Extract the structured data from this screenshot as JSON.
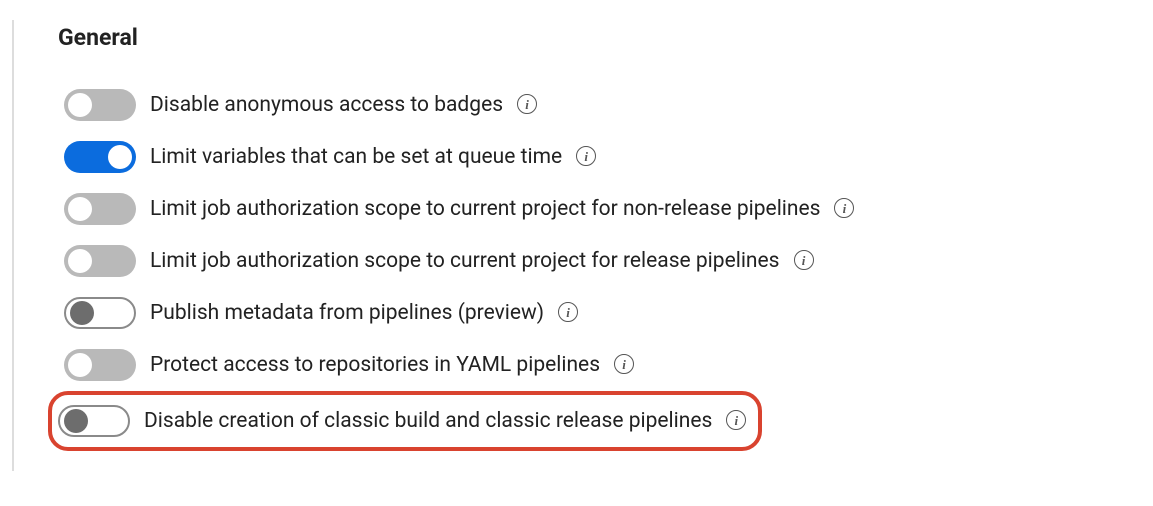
{
  "section": {
    "title": "General"
  },
  "settings": [
    {
      "label": "Disable anonymous access to badges",
      "state": "off-filled"
    },
    {
      "label": "Limit variables that can be set at queue time",
      "state": "on"
    },
    {
      "label": "Limit job authorization scope to current project for non-release pipelines",
      "state": "off-filled"
    },
    {
      "label": "Limit job authorization scope to current project for release pipelines",
      "state": "off-filled"
    },
    {
      "label": "Publish metadata from pipelines (preview)",
      "state": "off-outline"
    },
    {
      "label": "Protect access to repositories in YAML pipelines",
      "state": "off-filled"
    },
    {
      "label": "Disable creation of classic build and classic release pipelines",
      "state": "off-outline",
      "highlight": true
    }
  ]
}
